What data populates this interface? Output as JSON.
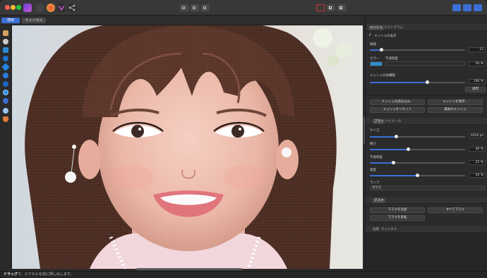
{
  "toolbar": {
    "apply_label": "適用",
    "cancel_label": "キャンセル"
  },
  "status": {
    "bold": "ドラッグ",
    "text": "で、ピクセルを前に押し出します。"
  },
  "panel": {
    "tabs1": [
      "メッシュ",
      "ヒストグラム"
    ],
    "show_mesh_label": "メッシュの表示",
    "grid_label": "間隔",
    "grid_value": "15",
    "grid_fraction": 0.12,
    "color_label": "カラー",
    "opacity_label": "不透明度",
    "color_opacity_value": "50 %",
    "mesh_opacity_label": "メッシュの再構築",
    "mesh_opacity_value": "100 %",
    "mesh_fraction": 0.6,
    "apply_label": "適用",
    "buttons": [
      "メッシュの読み込み...",
      "メッシュを保存...",
      "メッシュをリセット",
      "最後のメッシュ"
    ],
    "tabs2": [
      "ブラシ",
      "ナビゲータ"
    ],
    "size_label": "サイズ",
    "size_value": "1024 px",
    "size_fraction": 0.28,
    "density_label": "硬さ",
    "density_value": "40 %",
    "density_fraction": 0.4,
    "opacity2_label": "不透明度",
    "opacity2_value": "25 %",
    "opacity2_fraction": 0.25,
    "speed_label": "速度",
    "speed_value": "50 %",
    "speed_fraction": 0.5,
    "pressure_label": "ランプ",
    "pressure_value": "ガウス",
    "mask_section": "マスク",
    "mask_buttons": [
      "マスクを追加",
      "すべてマスク",
      "マスクを反転"
    ],
    "tabs3": [
      "画層",
      "チャンネル"
    ]
  },
  "colors": {
    "accent": "#3b6fd6",
    "swatch": "#2c8fc9"
  }
}
